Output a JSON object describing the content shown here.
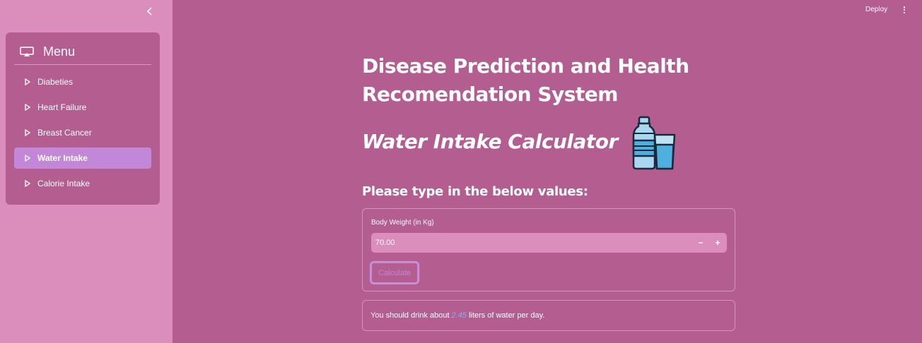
{
  "sidebar": {
    "menu_title": "Menu",
    "items": [
      {
        "label": "Diabeties",
        "active": false
      },
      {
        "label": "Heart Failure",
        "active": false
      },
      {
        "label": "Breast Cancer",
        "active": false
      },
      {
        "label": "Water Intake",
        "active": true
      },
      {
        "label": "Calorie Intake",
        "active": false
      }
    ]
  },
  "header": {
    "deploy_label": "Deploy"
  },
  "main": {
    "title": "Disease Prediction and Health Recomendation System",
    "subtitle": "Water Intake Calculator",
    "prompt": "Please type in the below values:",
    "form": {
      "field_label": "Body Weight (in Kg)",
      "value": "70.00",
      "minus": "−",
      "plus": "+",
      "button_label": "Calculate"
    },
    "result": {
      "prefix": "You should drink about",
      "value": "2.45",
      "suffix": "liters of water per day."
    }
  },
  "colors": {
    "main_bg": "#b45d91",
    "sidebar_bg": "#db8ebc",
    "active_item": "#c387d8",
    "result_value": "#7fb2f0"
  }
}
